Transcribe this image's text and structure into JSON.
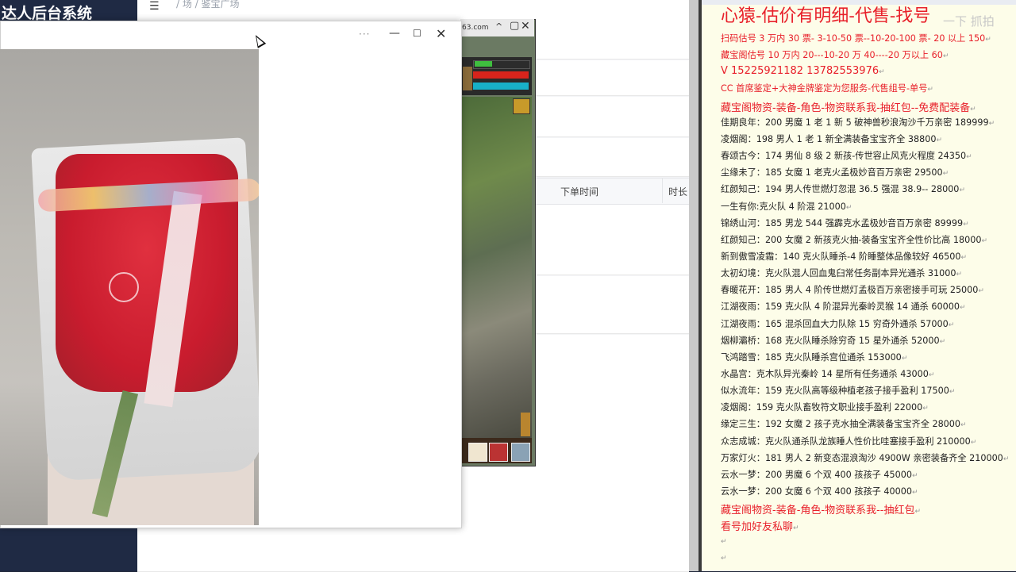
{
  "admin": {
    "logo": "达人后台系统",
    "menu_icon": "hamburger-icon",
    "breadcrumb": "/ 场 / 鉴宝广场",
    "table_headers": [
      "下单时间",
      "时长"
    ]
  },
  "game": {
    "url_fragment": "63.com",
    "caret": "^",
    "minimize": "▢",
    "close": "✕"
  },
  "viewer": {
    "more_label": "···",
    "minimize_label": "—",
    "maximize_label": "☐",
    "close_label": "✕"
  },
  "doc": {
    "title": "心猿-估价有明细-代售-找号",
    "watermark": "一下 抓拍",
    "paragraph_mark": "↵",
    "lines": [
      {
        "text": "扫码估号 3 万内 30 票- 3-10-50 票--10-20-100 票- 20 以上 150",
        "red": true
      },
      {
        "text": "藏宝阁估号 10 万内 20---10-20 万 40----20 万以上 60",
        "red": true
      },
      {
        "text": "V 15225921182    13782553976",
        "red": true,
        "big": true
      },
      {
        "text": "CC 首席鉴定+大神金牌鉴定为您服务-代售组号-单号",
        "red": true
      },
      {
        "text": "藏宝阁物资-装备-角色-物资联系我-抽红包--免费配装备",
        "red": true,
        "big": true
      },
      {
        "text": "佳期良年：200 男魔 1 老 1 新 5 破神兽秒浪淘沙千万亲密 189999",
        "red": false
      },
      {
        "text": "凌烟阁：198 男人 1 老 1 新全满装备宝宝齐全 38800",
        "red": false
      },
      {
        "text": "春颂古今：174 男仙 8 级 2 新孩-传世容止风克火程度 24350",
        "red": false
      },
      {
        "text": "尘缘未了：185 女魔 1 老克火孟极妙音百万亲密 29500",
        "red": false
      },
      {
        "text": "红颜知己：194 男人传世燃灯忽混 36.5 强混 38.9-- 28000",
        "red": false
      },
      {
        "text": "一生有你:克火队 4 阶混 21000",
        "red": false
      },
      {
        "text": "锦绣山河：185 男龙 544 强霹克水孟极妙音百万亲密 89999",
        "red": false
      },
      {
        "text": "红颜知己：200 女魔 2 新孩克火抽-装备宝宝齐全性价比高 18000",
        "red": false
      },
      {
        "text": "新到傲雪凌霜：140 克火队睡杀-4 阶睡整体品像较好 46500",
        "red": false
      },
      {
        "text": "太初幻境：克火队混人回血鬼臼常任务副本异光通杀 31000",
        "red": false
      },
      {
        "text": "春暖花开：185 男人 4 阶传世燃灯孟极百万亲密接手可玩 25000",
        "red": false
      },
      {
        "text": "江湖夜雨：159 克火队 4 阶混异光秦岭灵猴 14 通杀 60000",
        "red": false
      },
      {
        "text": "江湖夜雨：165 混杀回血大力队除 15 穷奇外通杀 57000",
        "red": false
      },
      {
        "text": "烟柳灞桥：168 克火队睡杀除穷奇 15 星外通杀 52000",
        "red": false
      },
      {
        "text": "飞鸿踏雪：185 克火队睡杀宫位通杀 153000",
        "red": false
      },
      {
        "text": "水晶宫：克木队异光秦岭 14 星所有任务通杀 43000",
        "red": false
      },
      {
        "text": "似水流年：159 克火队高等级种植老孩子接手盈利 17500",
        "red": false
      },
      {
        "text": "凌烟阁：159 克火队畜牧符文职业接手盈利 22000",
        "red": false
      },
      {
        "text": "缘定三生：192 女魔 2 孩子克水抽全满装备宝宝齐全 28000",
        "red": false
      },
      {
        "text": "众志成城：克火队通杀队龙族睡人性价比哇塞接手盈利 210000",
        "red": false
      },
      {
        "text": "万家灯火：181 男人 2 新变态混浪淘沙 4900W 亲密装备齐全 210000",
        "red": false
      },
      {
        "text": "云水一梦：200 男魔 6 个双 400 孩孩子 45000",
        "red": false
      },
      {
        "text": "云水一梦：200 女魔 6 个双 400 孩孩子 40000",
        "red": false
      },
      {
        "text": "藏宝阁物资-装备-角色-物资联系我--抽红包",
        "red": true,
        "big": true
      },
      {
        "text": "看号加好友私聊",
        "red": true,
        "big": true
      },
      {
        "text": "",
        "red": false
      },
      {
        "text": "",
        "red": false
      }
    ]
  },
  "colors": {
    "accent_red": "#e8202a",
    "doc_bg": "#fdfde9",
    "admin_sidebar": "#1f2a44"
  }
}
